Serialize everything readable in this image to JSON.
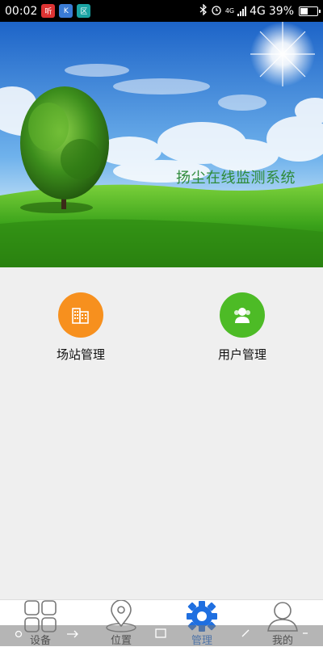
{
  "statusbar": {
    "time": "00:02",
    "apps": [
      "听",
      "K",
      "区"
    ],
    "network": "4G",
    "battery": "39%",
    "battery_level": 0.39,
    "small_net": "4G"
  },
  "banner": {
    "title": "扬尘在线监测系统"
  },
  "menu": {
    "station": "场站管理",
    "user": "用户管理"
  },
  "tabs": [
    {
      "label": "设备",
      "icon": "grid-icon"
    },
    {
      "label": "位置",
      "icon": "location-pin-icon"
    },
    {
      "label": "管理",
      "icon": "gear-icon"
    },
    {
      "label": "我的",
      "icon": "person-icon"
    }
  ],
  "colors": {
    "station_circle": "#f7901e",
    "user_circle": "#4dbb26",
    "tab_active": "#1f6fe0"
  }
}
